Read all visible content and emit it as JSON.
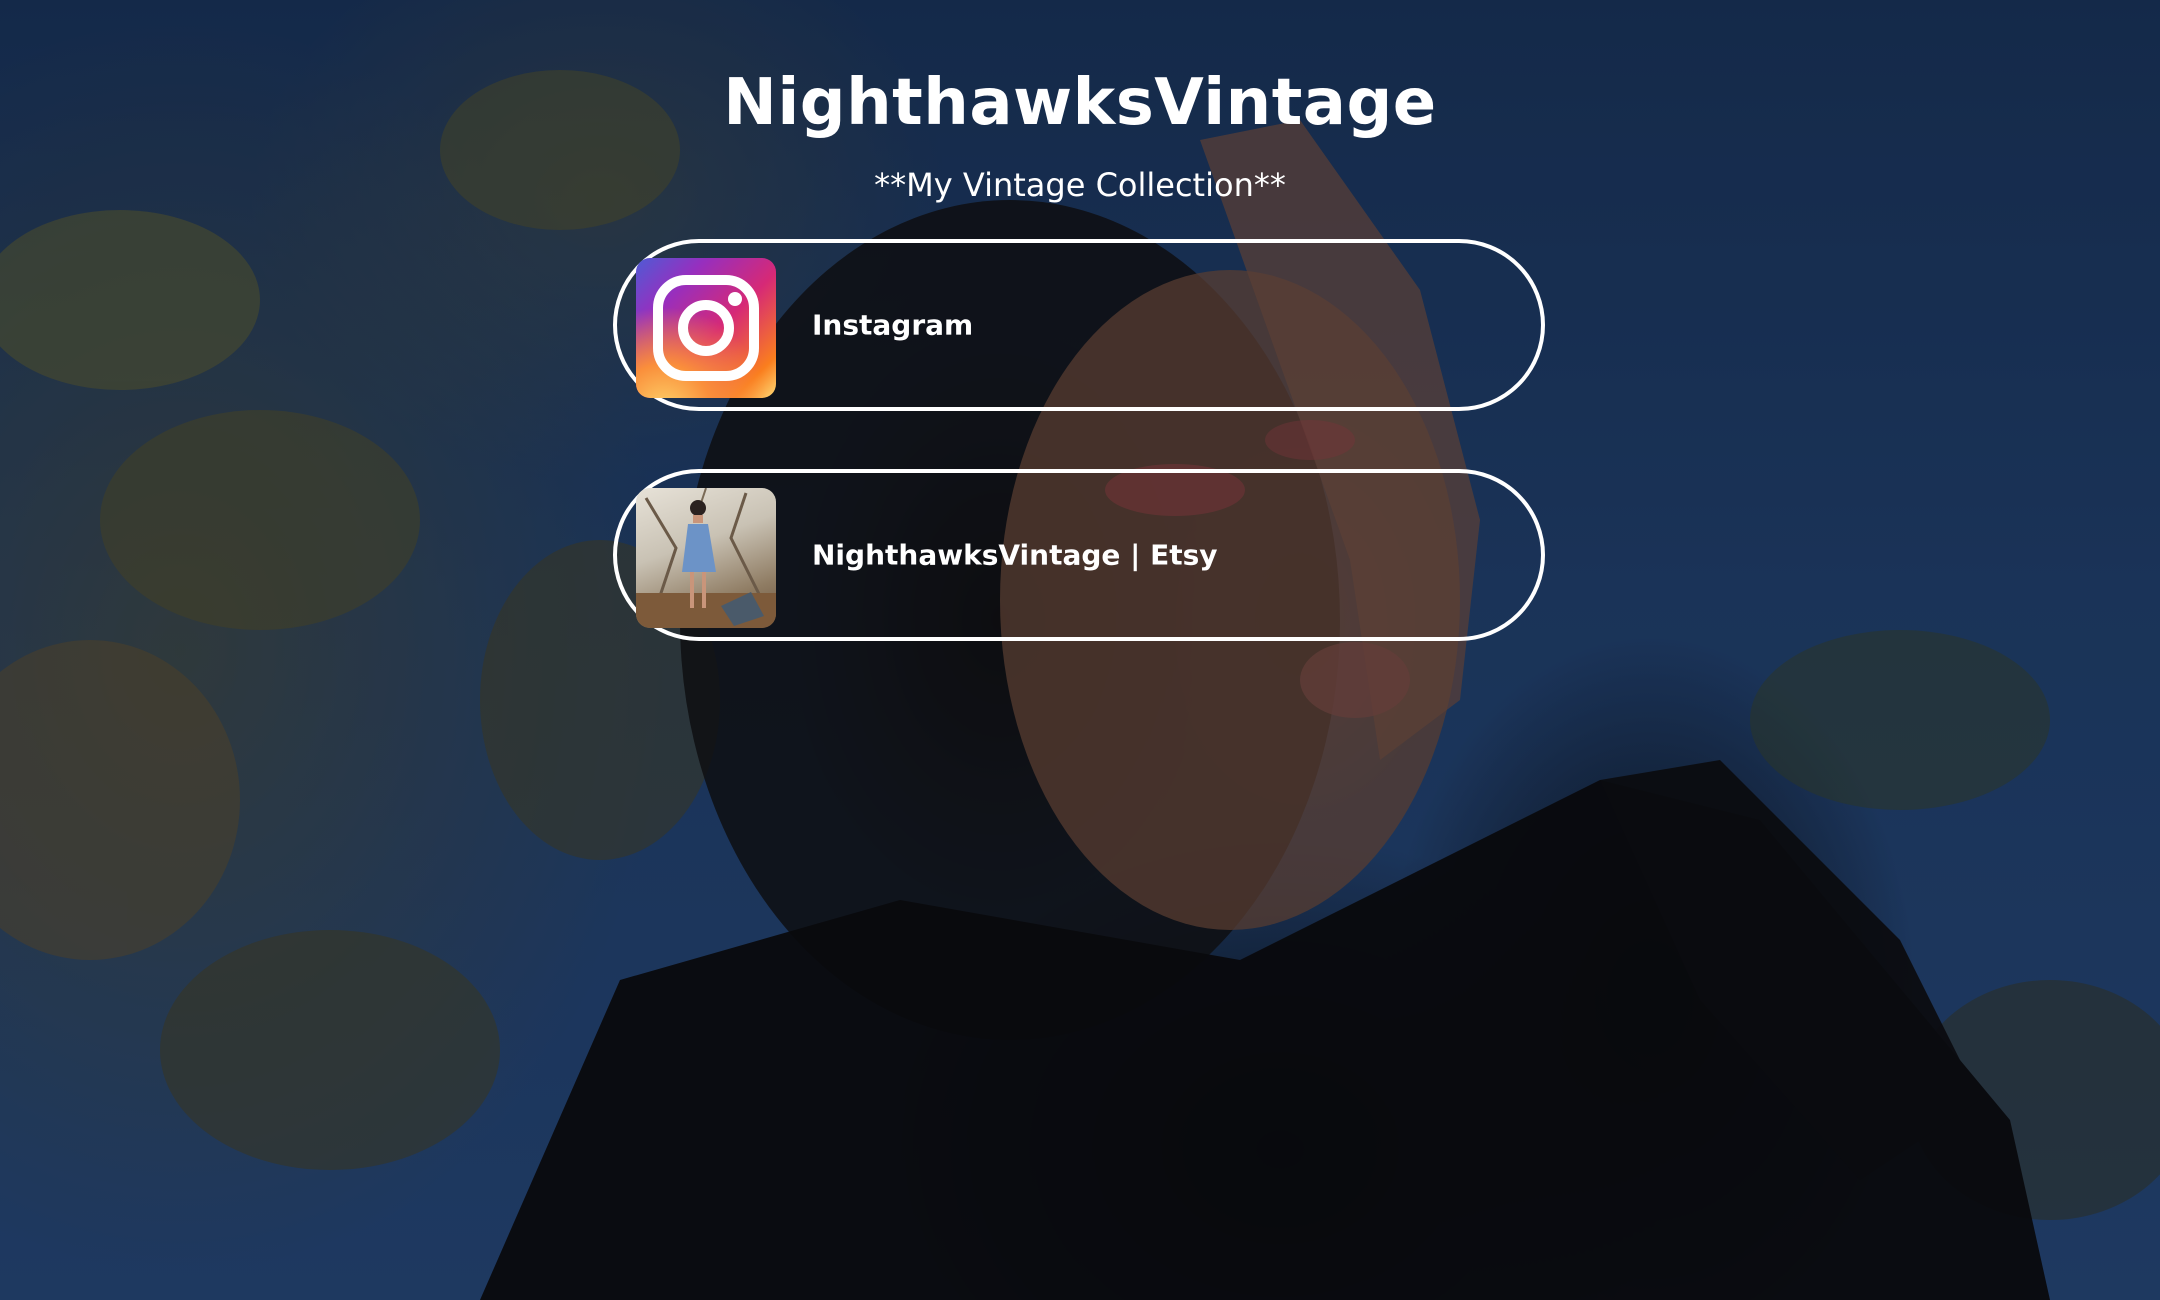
{
  "header": {
    "title": "NighthawksVintage",
    "subtitle": "**My Vintage Collection**"
  },
  "links": [
    {
      "label": "Instagram",
      "icon": "instagram-icon"
    },
    {
      "label": "NighthawksVintage | Etsy",
      "icon": "etsy-product-thumbnail"
    }
  ],
  "colors": {
    "text": "#ffffff",
    "card_border": "#ffffff",
    "background": "#1f3d6a"
  }
}
